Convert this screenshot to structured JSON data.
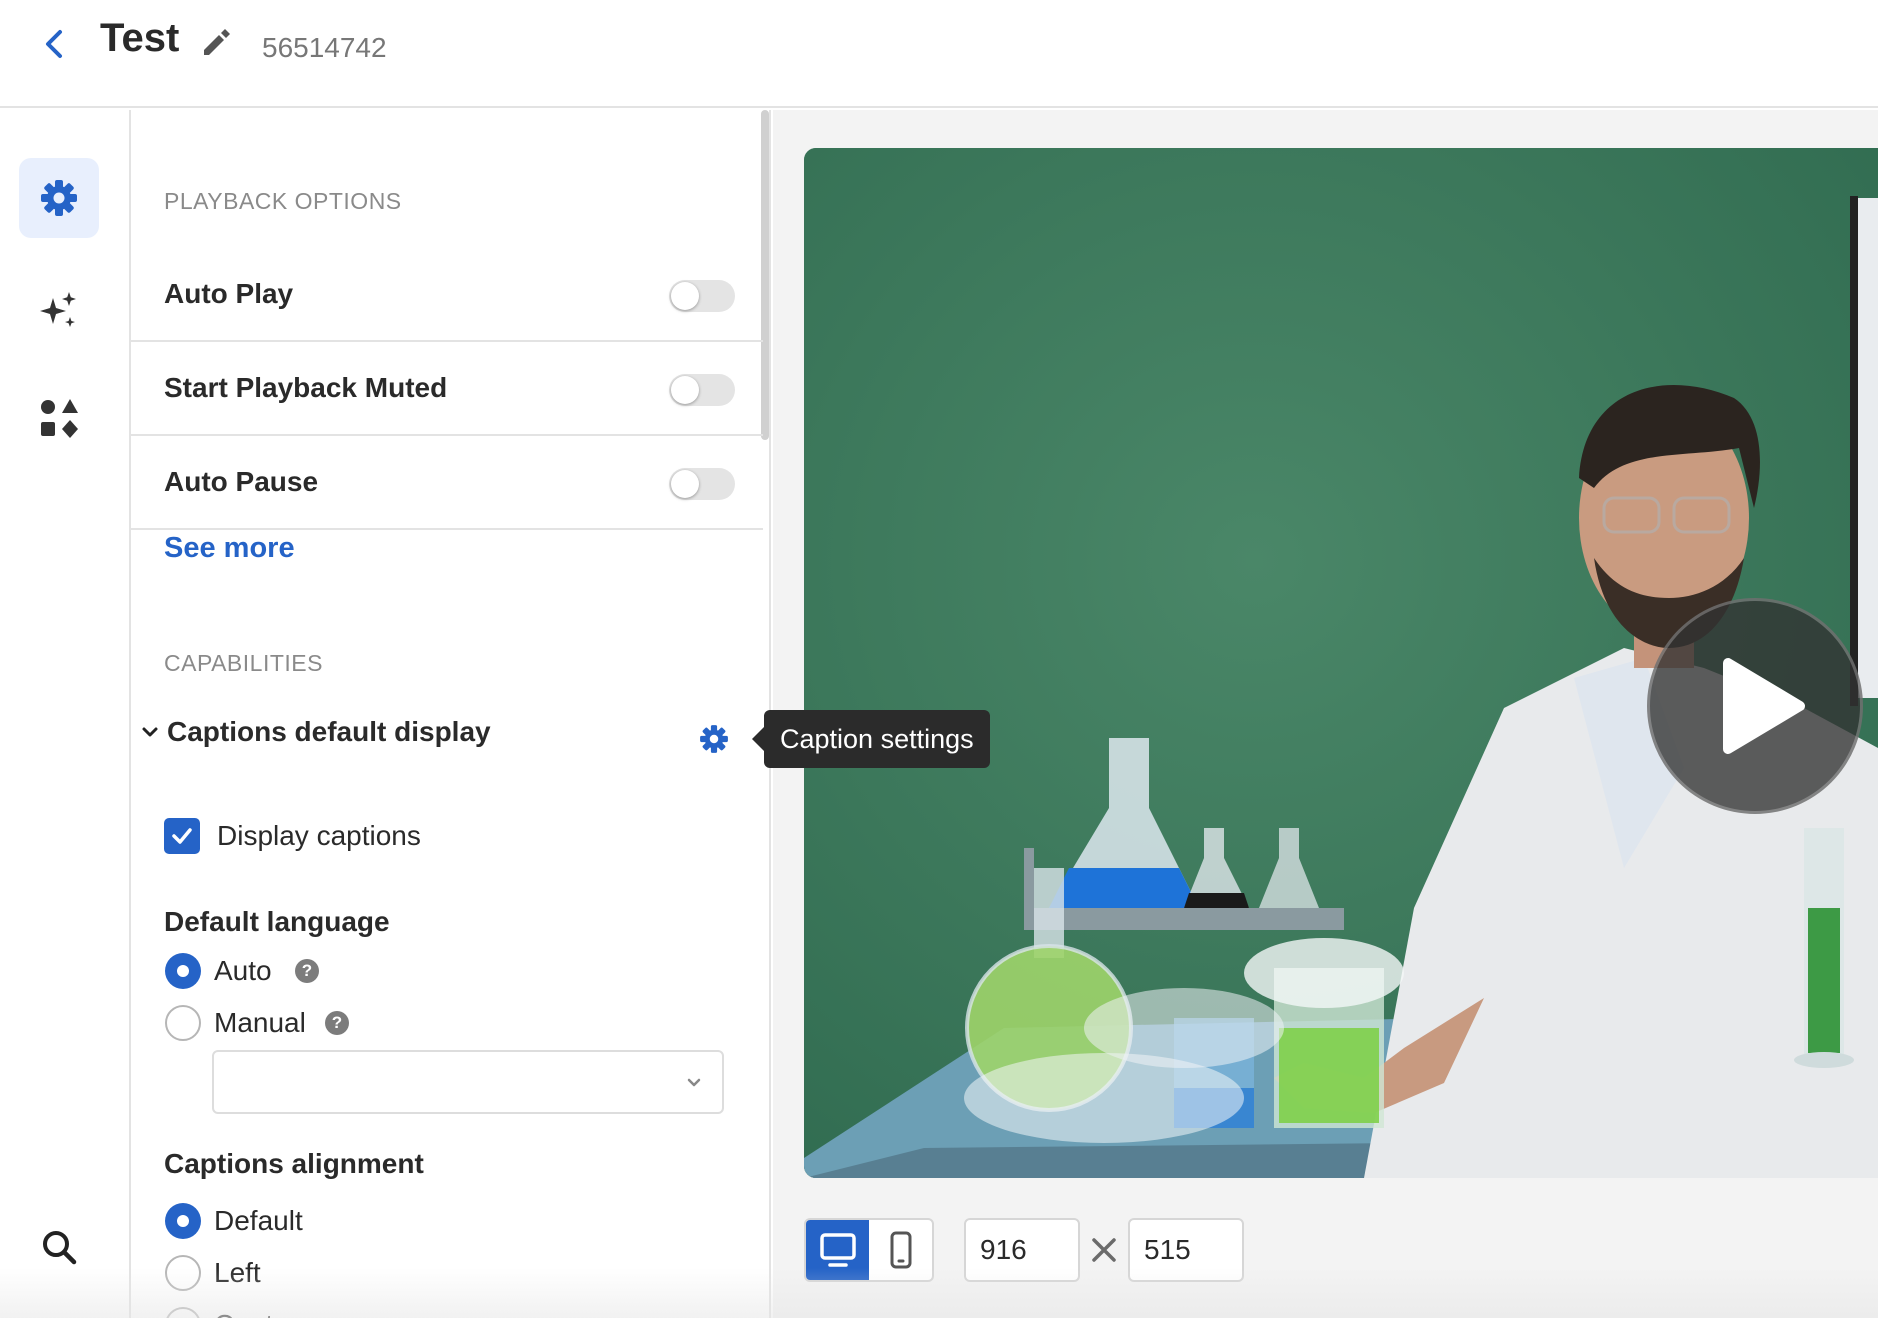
{
  "header": {
    "title": "Test",
    "entry_id": "56514742"
  },
  "rail": {
    "items": [
      {
        "name": "settings",
        "icon": "gear-icon",
        "active": true
      },
      {
        "name": "ai",
        "icon": "sparkles-icon",
        "active": false
      },
      {
        "name": "plugins",
        "icon": "shapes-icon",
        "active": false
      },
      {
        "name": "search",
        "icon": "search-icon",
        "active": false
      }
    ]
  },
  "playback": {
    "section_title": "PLAYBACK OPTIONS",
    "options": [
      {
        "label": "Auto Play",
        "enabled": false
      },
      {
        "label": "Start Playback Muted",
        "enabled": false
      },
      {
        "label": "Auto Pause",
        "enabled": false
      }
    ],
    "see_more": "See more"
  },
  "capabilities": {
    "section_title": "CAPABILITIES",
    "captions_header": "Captions default display",
    "display_captions_label": "Display captions",
    "display_captions_checked": true,
    "default_language": {
      "label": "Default language",
      "options": [
        "Auto",
        "Manual"
      ],
      "selected": "Auto",
      "manual_select_value": ""
    },
    "alignment": {
      "label": "Captions alignment",
      "options": [
        "Default",
        "Left",
        "Center"
      ],
      "selected": "Default"
    }
  },
  "tooltip": {
    "text": "Caption settings"
  },
  "preview": {
    "width_value": "916",
    "height_value": "515",
    "device_active": "desktop"
  },
  "colors": {
    "accent": "#2563c7",
    "video_bg": "#3f7a5e",
    "toggle_off": "#e4e4e4"
  }
}
